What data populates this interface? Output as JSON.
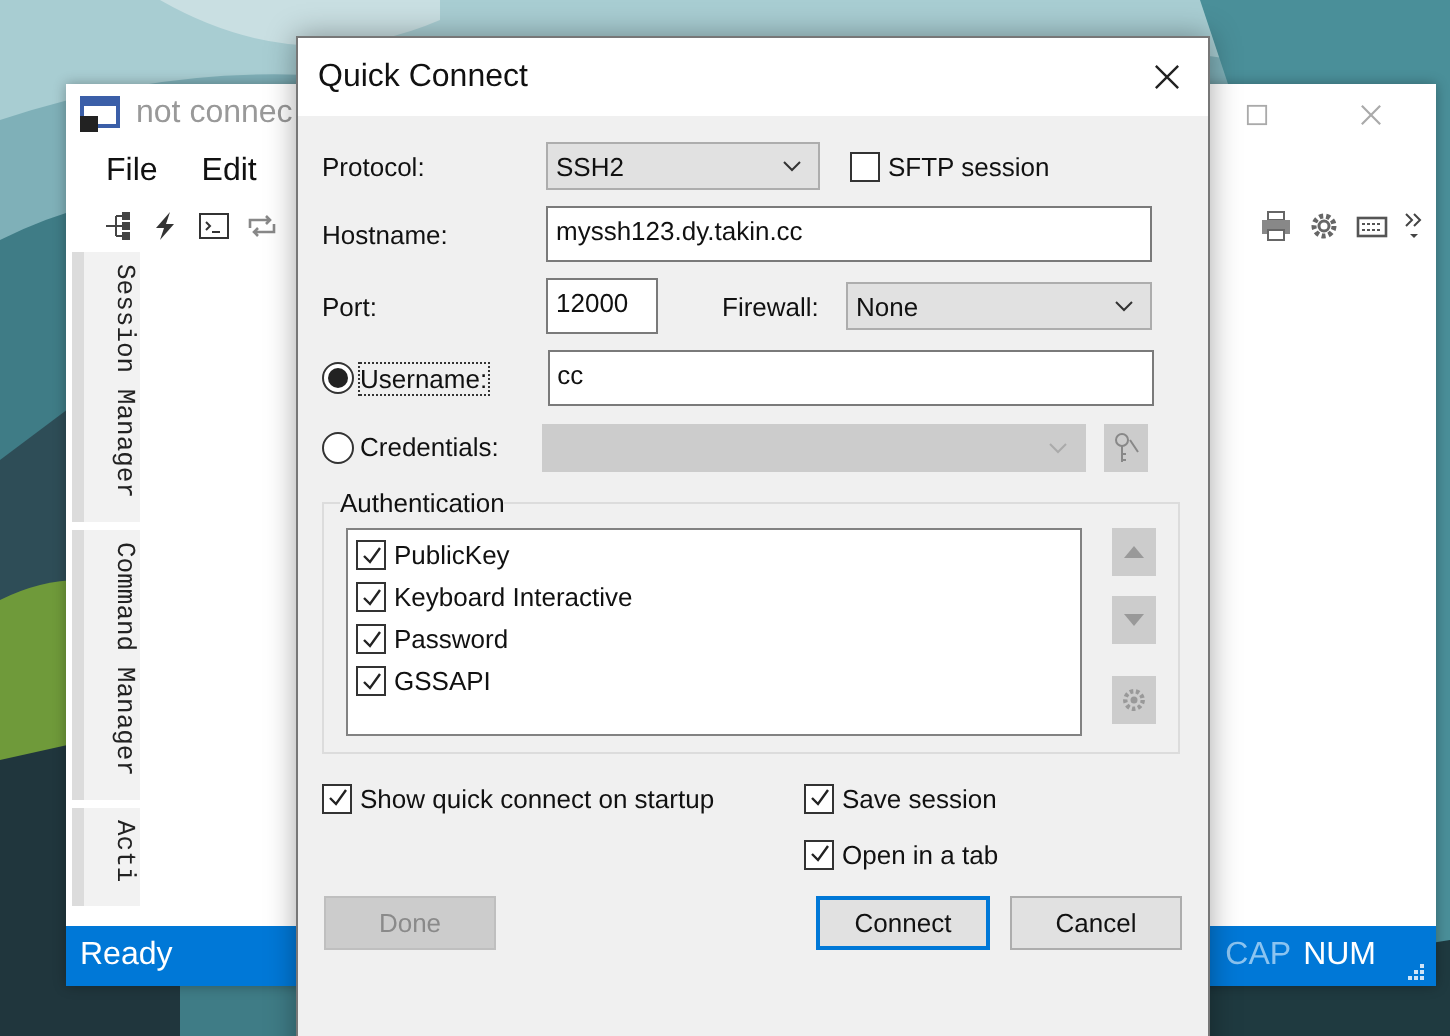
{
  "background_window": {
    "title": "not connec",
    "menu": [
      "File",
      "Edit"
    ],
    "side_tabs": [
      "Session Manager",
      "Command Manager",
      "Acti"
    ],
    "status_bar": {
      "text": "Ready",
      "indicators": [
        {
          "label": "CAP",
          "active": false
        },
        {
          "label": "NUM",
          "active": true
        }
      ]
    }
  },
  "dialog": {
    "title": "Quick Connect",
    "protocol": {
      "label": "Protocol:",
      "value": "SSH2"
    },
    "sftp_session": {
      "label": "SFTP session",
      "checked": false
    },
    "hostname": {
      "label": "Hostname:",
      "value": "myssh123.dy.takin.cc"
    },
    "port": {
      "label": "Port:",
      "value": "12000"
    },
    "firewall": {
      "label": "Firewall:",
      "value": "None"
    },
    "login_options": [
      {
        "label": "Username:",
        "selected": true,
        "value": "cc"
      },
      {
        "label": "Credentials:",
        "selected": false
      }
    ],
    "authentication": {
      "title": "Authentication",
      "methods": [
        {
          "label": "PublicKey",
          "checked": true
        },
        {
          "label": "Keyboard Interactive",
          "checked": true
        },
        {
          "label": "Password",
          "checked": true
        },
        {
          "label": "GSSAPI",
          "checked": true
        }
      ]
    },
    "options": [
      {
        "label": "Show quick connect on startup",
        "checked": true
      },
      {
        "label": "Save session",
        "checked": true
      },
      {
        "label": "Open in a tab",
        "checked": true
      }
    ],
    "buttons": [
      {
        "label": "Done",
        "disabled": true,
        "default": false
      },
      {
        "label": "Connect",
        "disabled": false,
        "default": true
      },
      {
        "label": "Cancel",
        "disabled": false,
        "default": false
      }
    ]
  }
}
